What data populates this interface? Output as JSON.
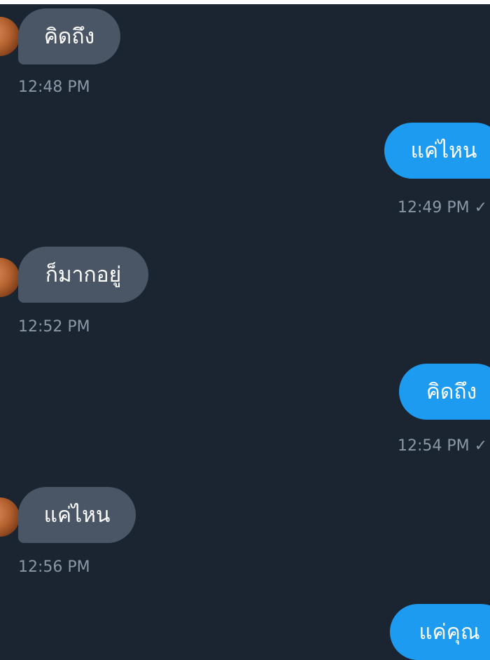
{
  "colors": {
    "background": "#1b2431",
    "incoming_bubble": "#4a5665",
    "outgoing_bubble": "#1d9bf0",
    "timestamp": "#8b98a5"
  },
  "messages": [
    {
      "direction": "incoming",
      "text": "คิดถึง",
      "time": "12:48 PM"
    },
    {
      "direction": "outgoing",
      "text": "แค่ไหน",
      "time": "12:49 PM ✓"
    },
    {
      "direction": "incoming",
      "text": "ก็มากอยู่",
      "time": "12:52 PM"
    },
    {
      "direction": "outgoing",
      "text": "คิดถึง",
      "time": "12:54 PM ✓"
    },
    {
      "direction": "incoming",
      "text": "แค่ไหน",
      "time": "12:56 PM"
    },
    {
      "direction": "outgoing",
      "text": "แค่คุณ"
    }
  ]
}
